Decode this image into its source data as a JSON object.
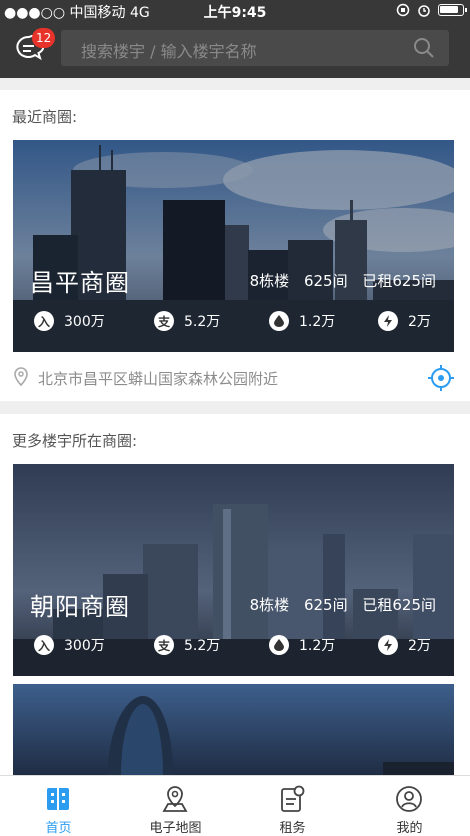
{
  "status_bar": {
    "carrier": "●●●○○ 中国移动   4G",
    "time": "上午9:45"
  },
  "header": {
    "message_badge": "12",
    "search_placeholder": "搜索楼宇 / 输入楼宇名称"
  },
  "recent": {
    "title": "最近商圈:",
    "card": {
      "name": "昌平商圈",
      "buildings": "8栋楼",
      "rooms": "625间",
      "rented": "已租625间",
      "stats": [
        {
          "icon": "入",
          "value": "300万"
        },
        {
          "icon": "支",
          "value": "5.2万"
        },
        {
          "icon": "water-drop-icon",
          "value": "1.2万"
        },
        {
          "icon": "lightning-icon",
          "value": "2万"
        }
      ]
    },
    "location": "北京市昌平区蟒山国家森林公园附近"
  },
  "more": {
    "title": "更多楼宇所在商圈:",
    "cards": [
      {
        "name": "朝阳商圈",
        "buildings": "8栋楼",
        "rooms": "625间",
        "rented": "已租625间",
        "stats": [
          {
            "icon": "入",
            "value": "300万"
          },
          {
            "icon": "支",
            "value": "5.2万"
          },
          {
            "icon": "water-drop-icon",
            "value": "1.2万"
          },
          {
            "icon": "lightning-icon",
            "value": "2万"
          }
        ]
      }
    ]
  },
  "tabbar": {
    "tabs": [
      {
        "label": "首页",
        "active": true
      },
      {
        "label": "电子地图",
        "active": false
      },
      {
        "label": "租务",
        "active": false
      },
      {
        "label": "我的",
        "active": false
      }
    ]
  },
  "colors": {
    "accent": "#2b9cf0",
    "badge": "#e8332a",
    "header_bg": "#383838"
  }
}
